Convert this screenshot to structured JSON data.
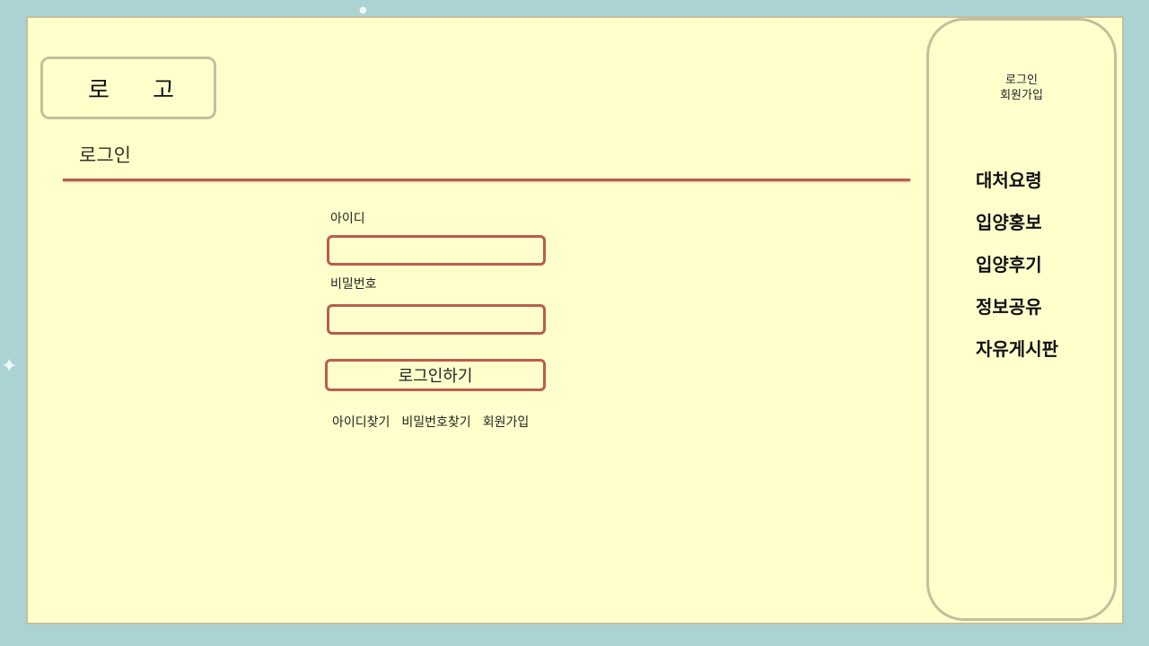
{
  "header": {
    "logo": "로 고",
    "title": "로그인"
  },
  "login_form": {
    "id_label": "아이디",
    "id_value": "",
    "password_label": "비밀번호",
    "password_value": "",
    "submit_label": "로그인하기",
    "links": {
      "find_id": "아이디찾기",
      "find_password": "비밀번호찾기",
      "signup": "회원가입"
    }
  },
  "sidebar": {
    "account_links": {
      "login": "로그인",
      "signup": "회원가입"
    },
    "menu": [
      {
        "label": "대처요령"
      },
      {
        "label": "입양홍보"
      },
      {
        "label": "입양후기"
      },
      {
        "label": "정보공유"
      },
      {
        "label": "자유게시판"
      }
    ]
  },
  "colors": {
    "background": "#acd3d3",
    "page": "#ffffcc",
    "accent": "#b95d4c",
    "border": "#c2bf9c"
  }
}
